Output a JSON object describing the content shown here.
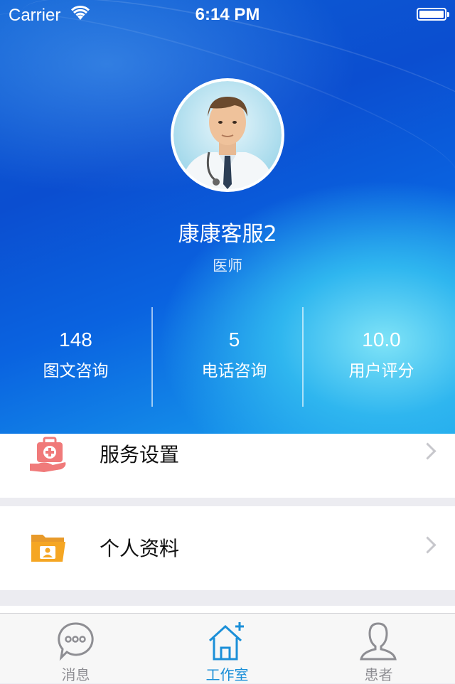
{
  "status_bar": {
    "carrier": "Carrier",
    "time": "6:14 PM",
    "icons": [
      "wifi-icon",
      "battery-icon"
    ]
  },
  "profile": {
    "name": "康康客服2",
    "role": "医师"
  },
  "stats": [
    {
      "value": "148",
      "label": "图文咨询"
    },
    {
      "value": "5",
      "label": "电话咨询"
    },
    {
      "value": "10.0",
      "label": "用户评分"
    }
  ],
  "menu": [
    {
      "label": "服务设置",
      "icon": "medical-kit-hand-icon"
    },
    {
      "label": "个人资料",
      "icon": "profile-folder-icon"
    }
  ],
  "tabbar": [
    {
      "label": "消息",
      "icon": "chat-bubble-icon",
      "active": false
    },
    {
      "label": "工作室",
      "icon": "house-plus-icon",
      "active": true
    },
    {
      "label": "患者",
      "icon": "person-icon",
      "active": false
    }
  ],
  "colors": {
    "accent": "#1b8fd8",
    "hero_blue": "#0b4ed0",
    "icon_red": "#f07a7a",
    "icon_orange": "#f5a623"
  }
}
